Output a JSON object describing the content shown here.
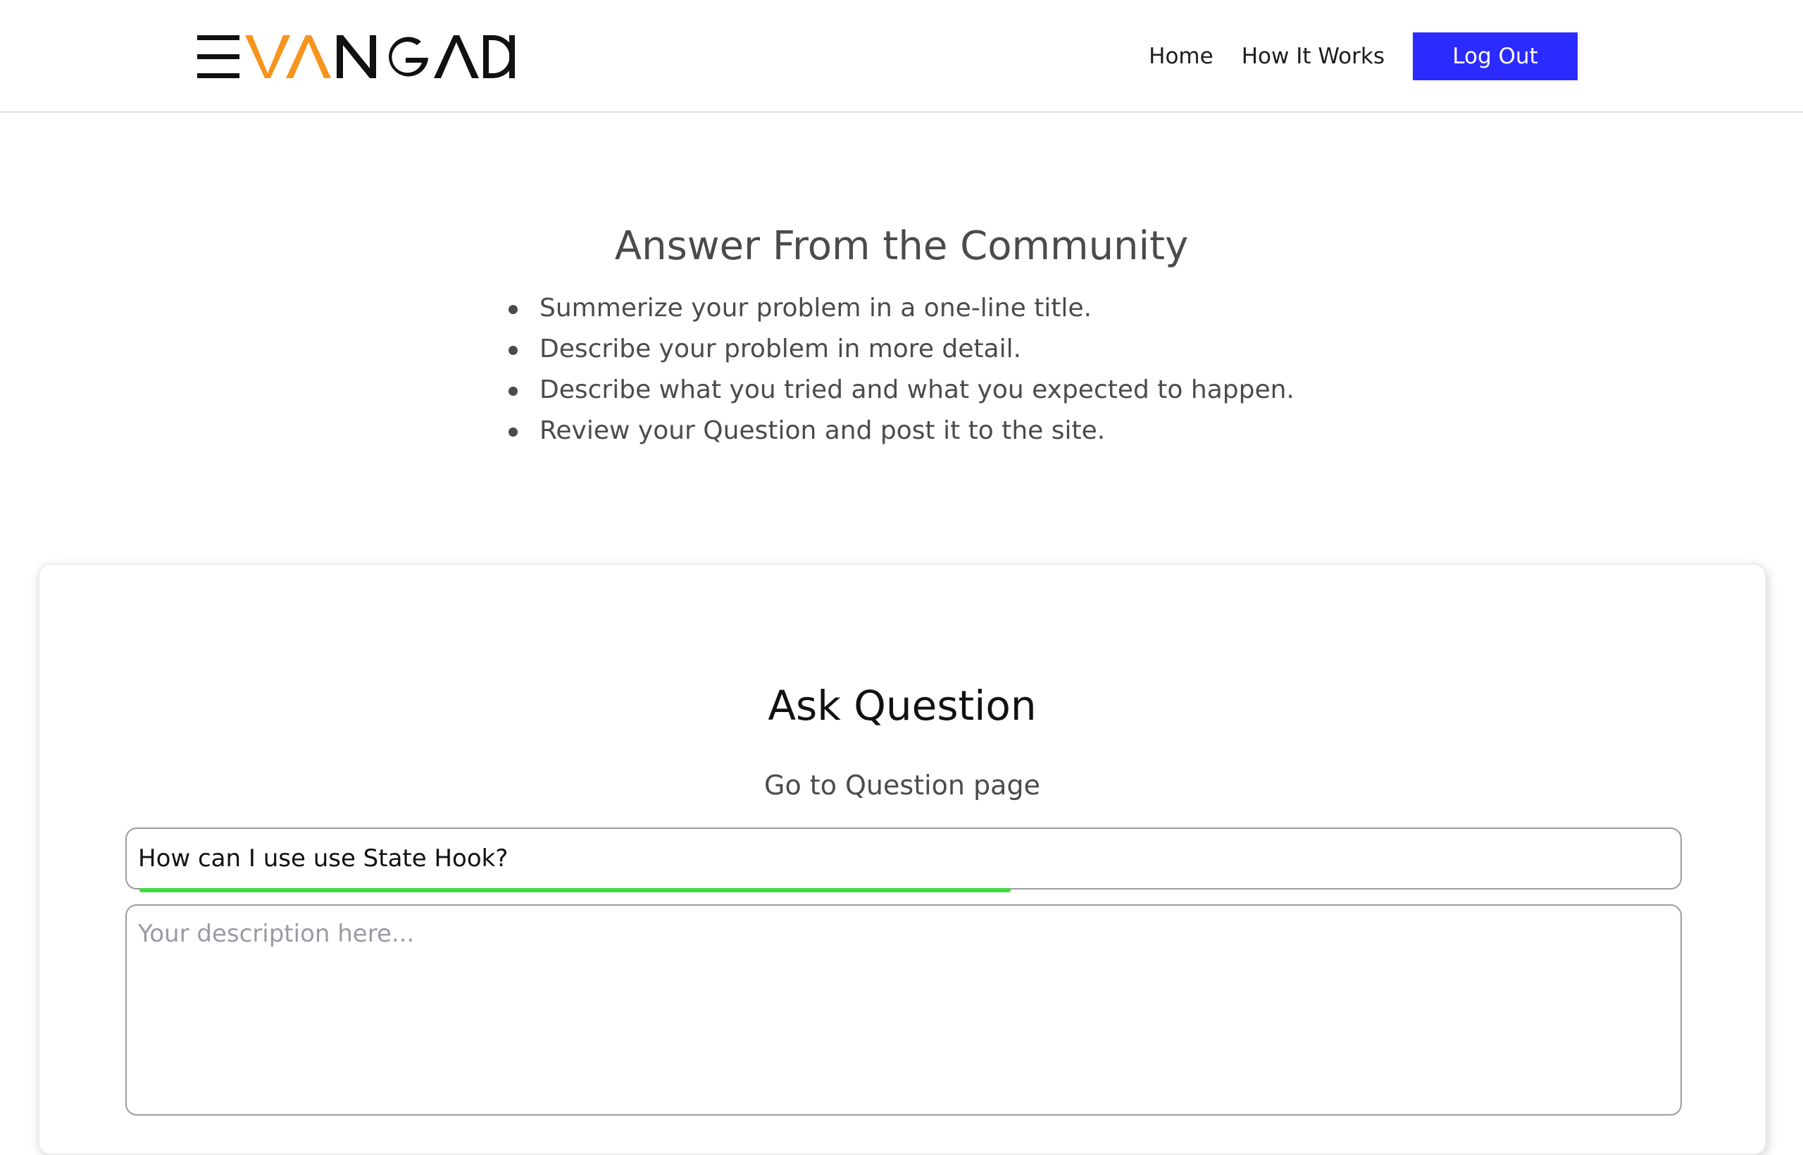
{
  "header": {
    "logo_text": "EVANGADI",
    "nav": {
      "home": "Home",
      "how_it_works": "How It Works",
      "logout": "Log Out"
    },
    "colors": {
      "logout_bg": "#2b2bff",
      "logo_dark": "#111111",
      "logo_accent": "#f7941d"
    }
  },
  "intro": {
    "title": "Answer From the Community",
    "steps": [
      "Summerize your problem in a one-line title.",
      "Describe your problem in more detail.",
      "Describe what you tried and what you expected to happen.",
      "Review your Question and post it to the site."
    ]
  },
  "form": {
    "title": "Ask Question",
    "subtitle_link": "Go to Question page",
    "title_input": {
      "value": "How can I use use State Hook?",
      "progress": 0.57,
      "progress_color": "#3fdc3f"
    },
    "description": {
      "placeholder": "Your description here...",
      "value": ""
    }
  }
}
